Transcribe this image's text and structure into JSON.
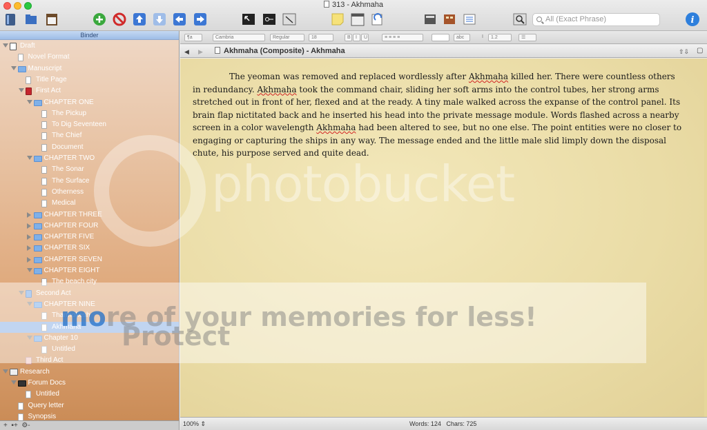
{
  "window": {
    "title": "313 - Akhmaha"
  },
  "toolbar": {
    "search_placeholder": "All (Exact Phrase)",
    "icons": [
      "binder-icon",
      "collections-icon",
      "inspector-icon",
      "add-icon",
      "delete-icon",
      "move-up-icon",
      "move-down-icon",
      "move-left-icon",
      "move-right-icon",
      "composition-icon",
      "keywords-icon",
      "split-icon",
      "note-icon",
      "corkboard-icon",
      "outliner-icon",
      "scrivenings-icon",
      "search-icon",
      "info-icon"
    ]
  },
  "binder": {
    "header": "Binder",
    "items": [
      {
        "label": "Draft",
        "depth": 0,
        "icon": "scriv",
        "open": true
      },
      {
        "label": "Novel Format",
        "depth": 1,
        "icon": "page"
      },
      {
        "label": "Manuscript",
        "depth": 1,
        "icon": "folder",
        "open": true
      },
      {
        "label": "Title Page",
        "depth": 2,
        "icon": "page"
      },
      {
        "label": "First Act",
        "depth": 2,
        "icon": "redbook",
        "open": true
      },
      {
        "label": "CHAPTER ONE",
        "depth": 3,
        "icon": "folder",
        "open": true
      },
      {
        "label": "The Pickup",
        "depth": 4,
        "icon": "page"
      },
      {
        "label": "To Dig Seventeen",
        "depth": 4,
        "icon": "page"
      },
      {
        "label": "The Chief",
        "depth": 4,
        "icon": "page"
      },
      {
        "label": "Document",
        "depth": 4,
        "icon": "page"
      },
      {
        "label": "CHAPTER TWO",
        "depth": 3,
        "icon": "folder",
        "open": true
      },
      {
        "label": "The Sonar",
        "depth": 4,
        "icon": "page"
      },
      {
        "label": "The Surface",
        "depth": 4,
        "icon": "page"
      },
      {
        "label": "Otherness",
        "depth": 4,
        "icon": "page"
      },
      {
        "label": "Medical",
        "depth": 4,
        "icon": "page"
      },
      {
        "label": "CHAPTER THREE",
        "depth": 3,
        "icon": "folder",
        "open": false
      },
      {
        "label": "CHAPTER FOUR",
        "depth": 3,
        "icon": "folder",
        "open": false
      },
      {
        "label": "CHAPTER FIVE",
        "depth": 3,
        "icon": "folder",
        "open": false
      },
      {
        "label": "CHAPTER SIX",
        "depth": 3,
        "icon": "folder",
        "open": false
      },
      {
        "label": "CHAPTER SEVEN",
        "depth": 3,
        "icon": "folder",
        "open": false
      },
      {
        "label": "CHAPTER EIGHT",
        "depth": 3,
        "icon": "folder",
        "open": true
      },
      {
        "label": "The beach city",
        "depth": 4,
        "icon": "page"
      },
      {
        "label": "Second Act",
        "depth": 2,
        "icon": "bluebook",
        "open": true
      },
      {
        "label": "CHAPTER NINE",
        "depth": 3,
        "icon": "folder",
        "open": true
      },
      {
        "label": "Tharmokesh",
        "depth": 4,
        "icon": "page"
      },
      {
        "label": "Akhmaha",
        "depth": 4,
        "icon": "page",
        "selected": true
      },
      {
        "label": "Chapter 10",
        "depth": 3,
        "icon": "folder",
        "open": true
      },
      {
        "label": "Untitled",
        "depth": 4,
        "icon": "page"
      },
      {
        "label": "Third Act",
        "depth": 2,
        "icon": "pinkbook"
      },
      {
        "label": "Research",
        "depth": 0,
        "icon": "research",
        "open": true
      },
      {
        "label": "Forum Docs",
        "depth": 1,
        "icon": "darkfolder",
        "open": true
      },
      {
        "label": "Untitled",
        "depth": 2,
        "icon": "page"
      },
      {
        "label": "Query letter",
        "depth": 1,
        "icon": "page"
      },
      {
        "label": "Synopsis",
        "depth": 1,
        "icon": "page"
      }
    ]
  },
  "formatbar": {
    "font_family": "Cambria",
    "font_style": "Regular",
    "font_size": "18",
    "line_spacing": "1.2",
    "highlight": "abc"
  },
  "editor": {
    "header_title": "Akhmaha (Composite) - Akhmaha",
    "text": "The yeoman was removed and replaced wordlessly after Akhmaha killed her.  There were countless others in redundancy.  Akhmaha took the command chair, sliding her soft arms into the control tubes, her strong arms stretched out in front of her, flexed and at the ready.  A tiny male walked across the expanse of the control panel.  Its brain flap nictitated back and he inserted his head into the private message module.  Words flashed across a nearby screen in a color wavelength Akhmaha had been altered to see, but no one else.  The point entities were no closer to engaging or capturing the ships in any way.  The message ended and the little male slid limply down the disposal chute, his purpose served and quite dead."
  },
  "status": {
    "zoom": "100%",
    "words": "Words: 124",
    "chars": "Chars: 725"
  },
  "watermark": {
    "brand": "photobucket",
    "banner_pre": "Protect ",
    "banner_mid": "mo",
    "banner_post": "re of your memories for less!"
  },
  "colors": {
    "binder_top": "#efd8c6",
    "binder_bottom": "#c98a54",
    "selection": "#8fb3e6",
    "editor_bg": "#eadca6"
  }
}
